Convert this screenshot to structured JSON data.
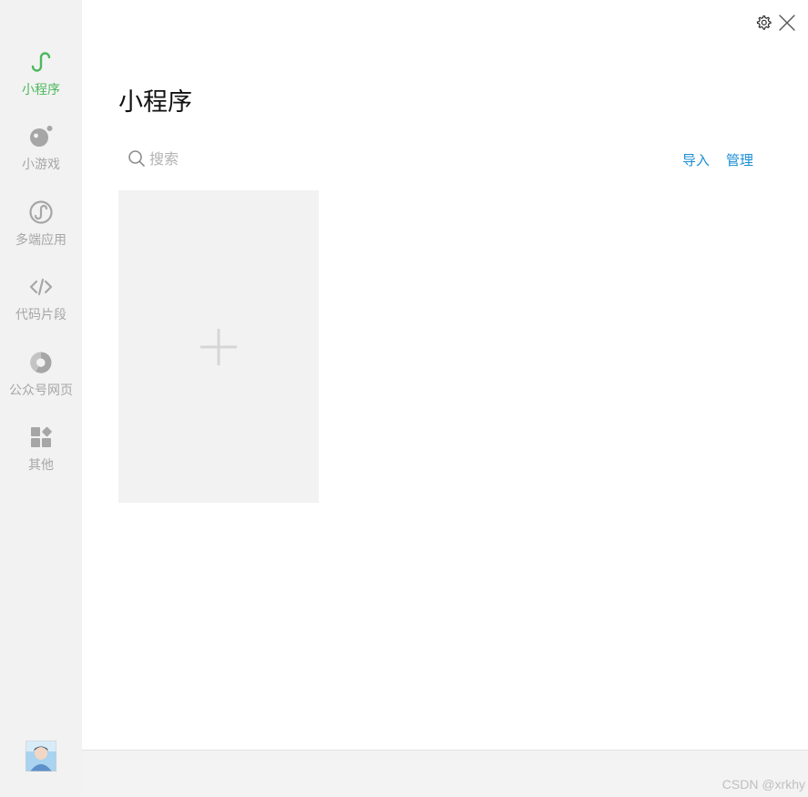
{
  "sidebar": {
    "items": [
      {
        "label": "小程序",
        "icon": "mini-program-icon",
        "active": true
      },
      {
        "label": "小游戏",
        "icon": "mini-game-icon",
        "active": false
      },
      {
        "label": "多端应用",
        "icon": "multi-platform-app-icon",
        "active": false
      },
      {
        "label": "代码片段",
        "icon": "code-snippet-icon",
        "active": false
      },
      {
        "label": "公众号网页",
        "icon": "official-account-web-icon",
        "active": false
      },
      {
        "label": "其他",
        "icon": "other-apps-icon",
        "active": false
      }
    ],
    "avatar": "user-avatar"
  },
  "header": {
    "settings_icon": "gear-icon",
    "close_icon": "close-icon"
  },
  "main": {
    "title": "小程序",
    "search": {
      "placeholder": "搜索",
      "value": ""
    },
    "actions": {
      "import_label": "导入",
      "manage_label": "管理"
    },
    "add_card_icon": "plus-icon"
  },
  "footer": {
    "watermark": "CSDN @xrkhy"
  },
  "colors": {
    "accent_green": "#4cb85c",
    "link_blue": "#1a8fd6",
    "sidebar_bg": "#f2f2f2",
    "inactive_gray": "#a6a6a6"
  }
}
